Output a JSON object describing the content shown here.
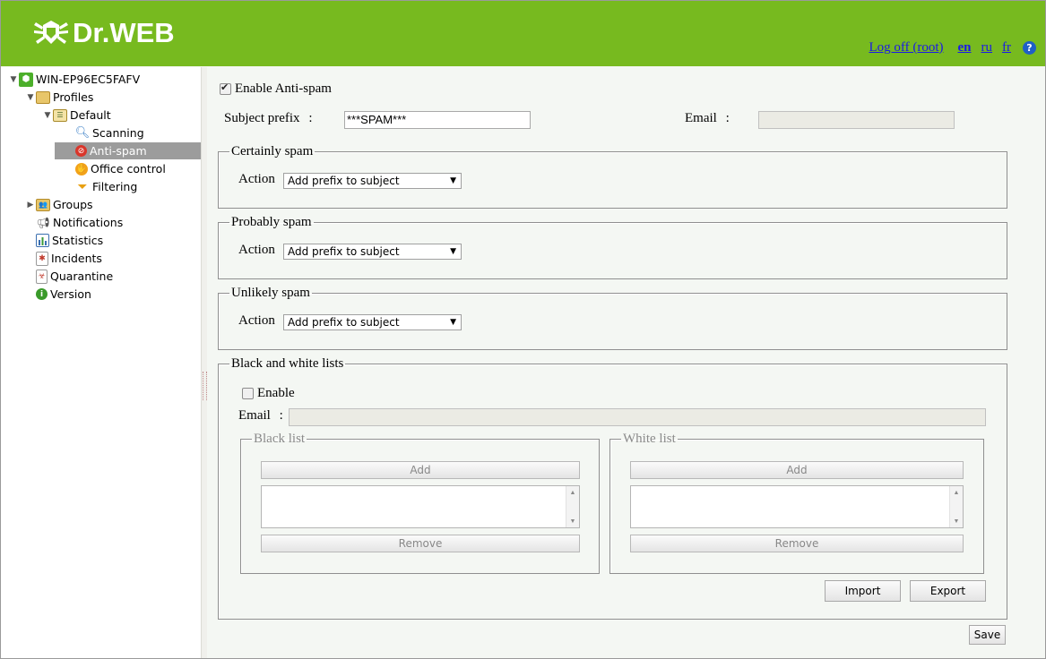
{
  "header": {
    "brand": "Dr.WEB",
    "logoff": "Log off (root)",
    "languages": [
      "en",
      "ru",
      "fr"
    ],
    "active_language": "en",
    "help": "?"
  },
  "tree": {
    "root": "WIN-EP96EC5FAFV",
    "profiles": "Profiles",
    "default": "Default",
    "scanning": "Scanning",
    "antispam": "Anti-spam",
    "office_control": "Office control",
    "filtering": "Filtering",
    "groups": "Groups",
    "notifications": "Notifications",
    "statistics": "Statistics",
    "incidents": "Incidents",
    "quarantine": "Quarantine",
    "version": "Version"
  },
  "main": {
    "enable_antispam_label": "Enable Anti-spam",
    "enable_antispam_checked": true,
    "subject_prefix_label": "Subject prefix",
    "subject_prefix_value": "***SPAM***",
    "email_label": "Email",
    "email_value": "",
    "colon": ":",
    "certainly": {
      "legend": "Certainly spam",
      "action_label": "Action",
      "action_value": "Add prefix to subject"
    },
    "probably": {
      "legend": "Probably spam",
      "action_label": "Action",
      "action_value": "Add prefix to subject"
    },
    "unlikely": {
      "legend": "Unlikely spam",
      "action_label": "Action",
      "action_value": "Add prefix to subject"
    },
    "bw": {
      "legend": "Black and white lists",
      "enable_label": "Enable",
      "enable_checked": false,
      "email_label": "Email",
      "email_value": "",
      "black": {
        "legend": "Black list",
        "add": "Add",
        "remove": "Remove"
      },
      "white": {
        "legend": "White list",
        "add": "Add",
        "remove": "Remove"
      },
      "import": "Import",
      "export": "Export"
    },
    "save": "Save"
  },
  "colors": {
    "header_bg": "#77ba1f",
    "link": "#1a1ae6",
    "selected_bg": "#9c9c9c"
  }
}
